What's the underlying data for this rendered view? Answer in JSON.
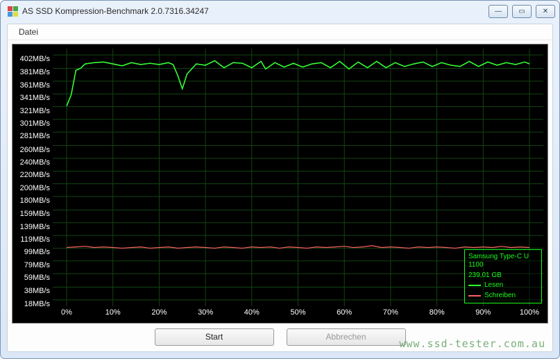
{
  "window": {
    "title": "AS SSD Kompression-Benchmark 2.0.7316.34247",
    "icon_colors": [
      "#d44",
      "#4a4",
      "#49d",
      "#dd4"
    ]
  },
  "menu": {
    "file": "Datei"
  },
  "legend": {
    "device": "Samsung Type-C U",
    "model_no": "1100",
    "capacity": "239,01 GB",
    "read_label": "Lesen",
    "write_label": "Schreiben",
    "read_color": "#33ff33",
    "write_color": "#ff6060"
  },
  "buttons": {
    "start": "Start",
    "cancel": "Abbrechen"
  },
  "watermark": "www.ssd-tester.com.au",
  "chart_data": {
    "type": "line",
    "xlabel": "",
    "ylabel": "",
    "xlim": [
      -3,
      103
    ],
    "ylim": [
      8,
      412
    ],
    "y_ticks": [
      18,
      38,
      59,
      79,
      99,
      119,
      139,
      159,
      180,
      200,
      220,
      240,
      260,
      281,
      301,
      321,
      341,
      361,
      381,
      402
    ],
    "y_tick_labels": [
      "18MB/s",
      "38MB/s",
      "59MB/s",
      "79MB/s",
      "99MB/s",
      "119MB/s",
      "139MB/s",
      "159MB/s",
      "180MB/s",
      "200MB/s",
      "220MB/s",
      "240MB/s",
      "260MB/s",
      "281MB/s",
      "301MB/s",
      "321MB/s",
      "341MB/s",
      "361MB/s",
      "381MB/s",
      "402MB/s"
    ],
    "x_ticks": [
      0,
      10,
      20,
      30,
      40,
      50,
      60,
      70,
      80,
      90,
      100
    ],
    "x_tick_labels": [
      "0%",
      "10%",
      "20%",
      "30%",
      "40%",
      "50%",
      "60%",
      "70%",
      "80%",
      "90%",
      "100%"
    ],
    "series": [
      {
        "name": "Lesen",
        "color": "#33ff33",
        "x": [
          0,
          1,
          2,
          3,
          4,
          6,
          8,
          10,
          12,
          14,
          16,
          18,
          20,
          22,
          23,
          24,
          25,
          26,
          28,
          30,
          32,
          34,
          36,
          38,
          40,
          42,
          43,
          45,
          47,
          49,
          51,
          53,
          55,
          57,
          59,
          61,
          63,
          65,
          67,
          69,
          71,
          73,
          75,
          77,
          79,
          81,
          83,
          85,
          87,
          89,
          91,
          93,
          95,
          97,
          99,
          100
        ],
        "y": [
          322,
          340,
          378,
          381,
          388,
          390,
          391,
          388,
          385,
          390,
          387,
          389,
          387,
          390,
          387,
          370,
          349,
          372,
          388,
          386,
          393,
          382,
          390,
          389,
          382,
          392,
          380,
          390,
          383,
          389,
          383,
          388,
          390,
          382,
          392,
          380,
          391,
          382,
          392,
          382,
          390,
          384,
          388,
          391,
          384,
          390,
          386,
          384,
          392,
          384,
          391,
          386,
          390,
          387,
          391,
          388
        ]
      },
      {
        "name": "Schreiben",
        "color": "#ff6060",
        "x": [
          0,
          2,
          4,
          6,
          8,
          10,
          12,
          14,
          16,
          18,
          20,
          22,
          24,
          26,
          28,
          30,
          32,
          34,
          36,
          38,
          40,
          42,
          44,
          46,
          48,
          50,
          52,
          54,
          56,
          58,
          60,
          62,
          64,
          66,
          68,
          70,
          72,
          74,
          76,
          78,
          80,
          82,
          84,
          86,
          88,
          90,
          92,
          94,
          96,
          98,
          100
        ],
        "y": [
          100,
          101,
          102,
          100,
          101,
          100,
          99,
          100,
          101,
          99,
          100,
          101,
          99,
          100,
          101,
          100,
          99,
          101,
          100,
          99,
          101,
          100,
          101,
          99,
          101,
          100,
          99,
          101,
          100,
          101,
          102,
          100,
          101,
          103,
          100,
          101,
          100,
          99,
          101,
          100,
          101,
          100,
          99,
          101,
          100,
          101,
          100,
          102,
          100,
          101,
          100
        ]
      }
    ]
  }
}
